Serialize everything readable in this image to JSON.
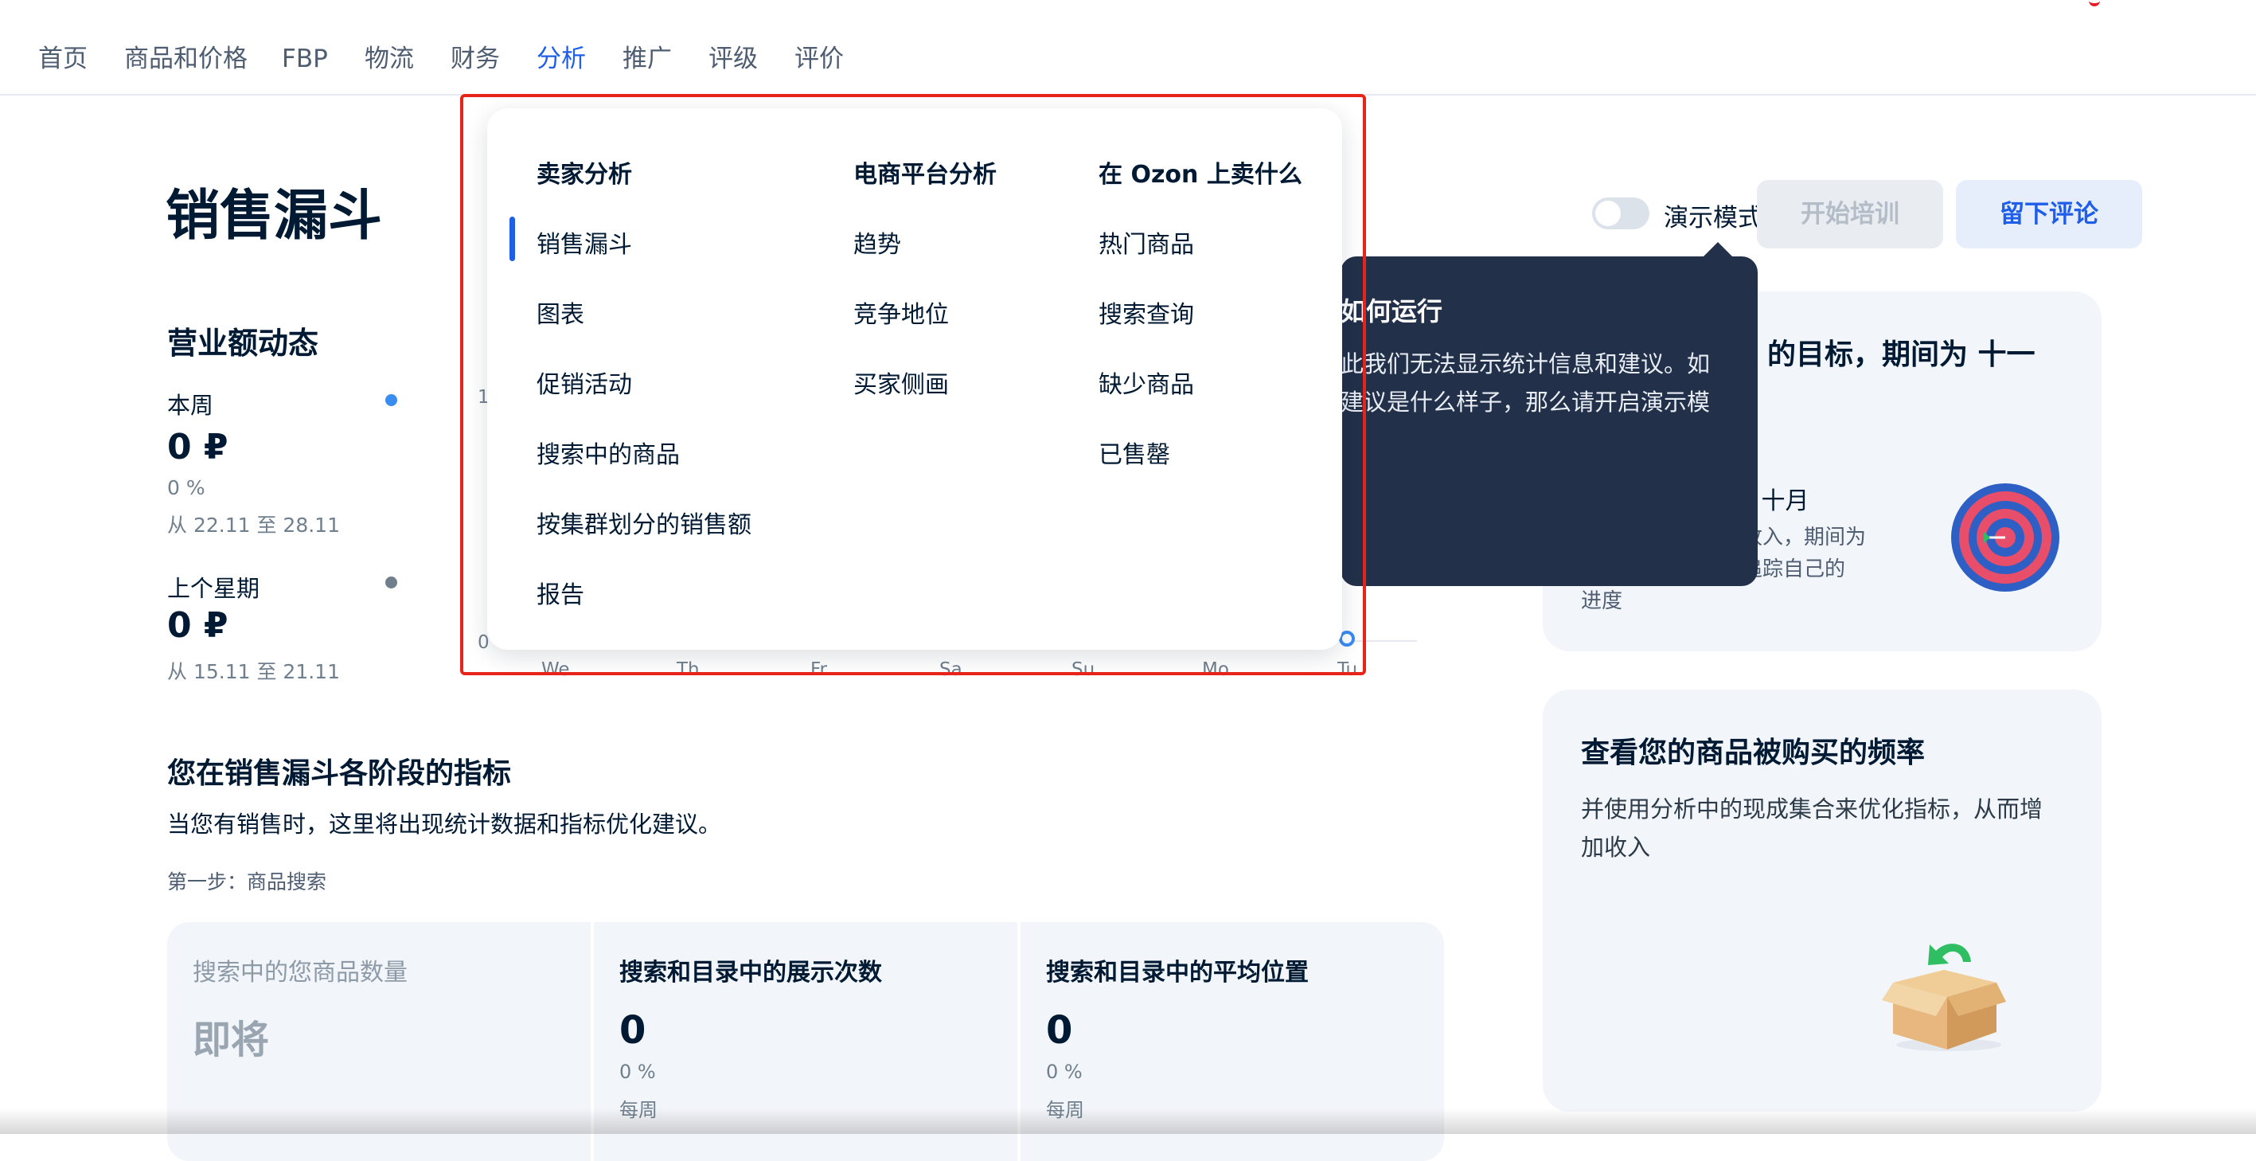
{
  "nav": {
    "items": [
      {
        "label": "首页"
      },
      {
        "label": "商品和价格"
      },
      {
        "label": "FBP"
      },
      {
        "label": "物流"
      },
      {
        "label": "财务"
      },
      {
        "label": "分析",
        "active": true
      },
      {
        "label": "推广"
      },
      {
        "label": "评级"
      },
      {
        "label": "评价"
      }
    ]
  },
  "page": {
    "title": "销售漏斗"
  },
  "revenue": {
    "title": "营业额动态",
    "this_week": {
      "label": "本周",
      "value": "0 ₽",
      "percent": "0 %",
      "range": "从 22.11 至 28.11",
      "color": "#3b8cf0"
    },
    "last_week": {
      "label": "上个星期",
      "value": "0 ₽",
      "range": "从 15.11 至 21.11",
      "color": "#707f8d"
    }
  },
  "chart_data": {
    "type": "line",
    "categories": [
      "We",
      "Th",
      "Fr",
      "Sa",
      "Su",
      "Mo",
      "Tu"
    ],
    "y_ticks": [
      "1",
      "0"
    ],
    "series": [
      {
        "values": [
          0,
          0,
          0,
          0,
          0,
          0,
          0
        ]
      }
    ]
  },
  "funnel": {
    "title": "您在销售漏斗各阶段的指标",
    "desc": "当您有销售时，这里将出现统计数据和指标优化建议。",
    "step": "第一步：商品搜索",
    "cards": [
      {
        "title": "搜索中的您商品数量",
        "value": "即将"
      },
      {
        "title": "搜索和目录中的展示次数",
        "value": "0",
        "percent": "0 %",
        "period": "每周"
      },
      {
        "title": "搜索和目录中的平均位置",
        "value": "0",
        "percent": "0 %",
        "period": "每周"
      }
    ]
  },
  "demo": {
    "label": "演示模式",
    "start_training": "开始培训",
    "leave_review": "留下评论"
  },
  "tooltip": {
    "title": "如何运行",
    "line1": "此我们无法显示统计信息和建议。如",
    "line2": "建议是什么样子，那么请开启演示模"
  },
  "goal_card": {
    "title": "的目标，期间为 十一",
    "subtitle": "间：）  十月",
    "line1": "增加收入，期间为",
    "line2": "标来追踪自己的",
    "line3": "进度"
  },
  "freq_card": {
    "title": "查看您的商品被购买的频率",
    "line1": "并使用分析中的现成集合来优化指标，从而增",
    "line2": "加收入"
  },
  "dropdown": {
    "columns": [
      {
        "title": "卖家分析",
        "items": [
          "销售漏斗",
          "图表",
          "促销活动",
          "搜索中的商品",
          "按集群划分的销售额",
          "报告"
        ]
      },
      {
        "title": "电商平台分析",
        "items": [
          "趋势",
          "竞争地位",
          "买家侧画"
        ]
      },
      {
        "title": "在 Ozon 上卖什么",
        "items": [
          "热门商品",
          "搜索查询",
          "缺少商品",
          "已售罄"
        ]
      }
    ]
  }
}
